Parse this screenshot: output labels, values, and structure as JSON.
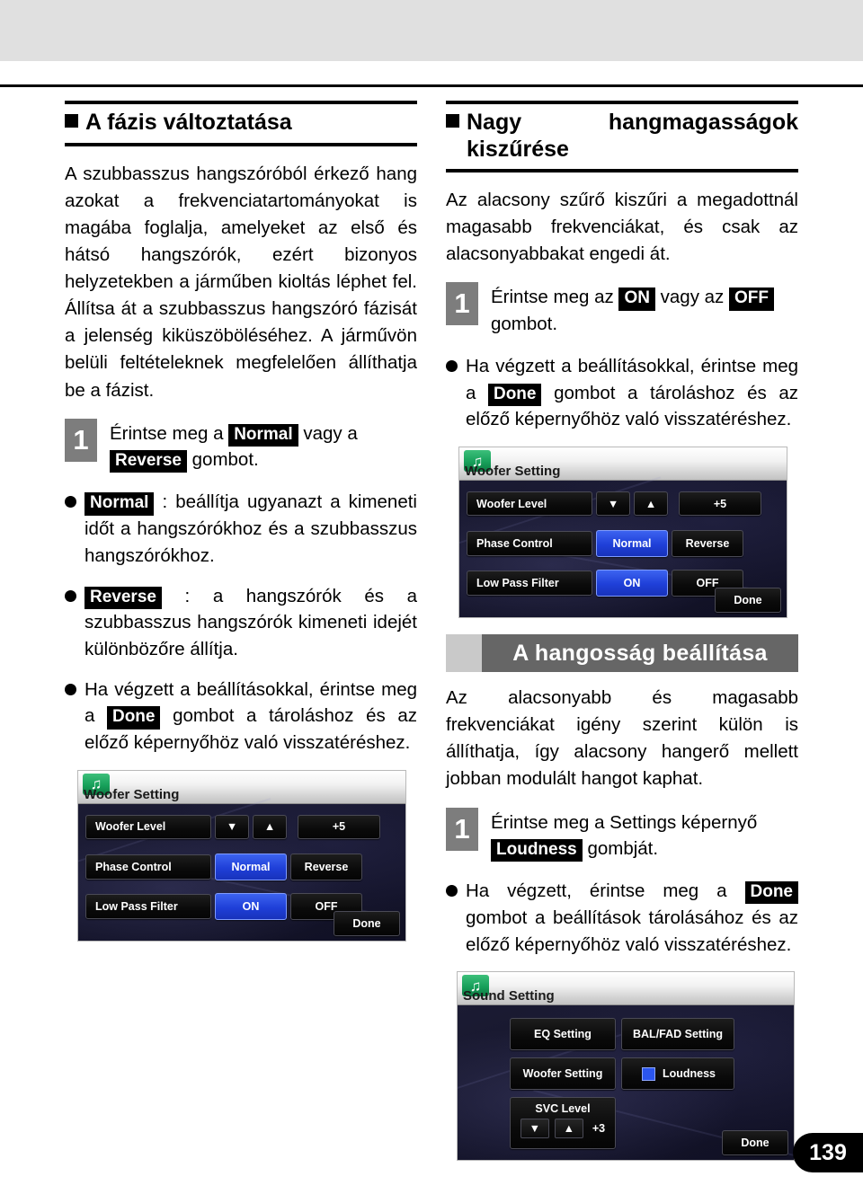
{
  "page": {
    "number": "139"
  },
  "left": {
    "heading": "A fázis változtatása",
    "intro": "A szubbasszus hangszóróból érkező hang azokat a frekvenciatartományokat is magába foglalja, amelyeket az első és hátsó hangszórók, ezért bizonyos helyzetekben a járműben kioltás léphet fel. Állítsa át a szubbasszus hangszóró fázisát a jelenség kiküszöböléséhez. A járművön belüli feltételeknek megfelelően állíthatja be a fázist.",
    "step1": {
      "num": "1",
      "text_before": "Érintse meg a",
      "chip1": "Normal",
      "text_mid": "vagy a",
      "chip2": "Reverse",
      "text_after": "gombot."
    },
    "bullets": [
      {
        "chip": "Normal",
        "text": ": beállítja ugyanazt a kimeneti időt a hangszórókhoz és a szubbasszus hangszórókhoz."
      },
      {
        "chip": "Reverse",
        "text": ":  a  hangszórók  és  a szubbasszus hangszórók kimeneti idejét különbözőre állítja."
      }
    ],
    "done_bullet": {
      "before": "Ha végzett a beállításokkal, érintse meg a",
      "chip": "Done",
      "after": "gombot a tároláshoz és az előző képernyőhöz való visszatéréshez."
    }
  },
  "right": {
    "heading_line1_a": "Nagy",
    "heading_line1_b": "hangmagasságok",
    "heading_line2": "kiszűrése",
    "intro": "Az alacsony szűrő kiszűri a megadottnál magasabb frekvenciákat, és csak az alacsonyabbakat engedi át.",
    "step1": {
      "num": "1",
      "text_before": "Érintse meg az",
      "chip1": "ON",
      "text_mid": "vagy az",
      "chip2": "OFF",
      "text_after": "gombot."
    },
    "done_bullet": {
      "before": "Ha végzett a beállításokkal, érintse meg a",
      "chip": "Done",
      "after": "gombot a tároláshoz és az előző képernyőhöz való visszatéréshez."
    },
    "banner": "A hangosság beállítása",
    "loudness_intro": "Az alacsonyabb és magasabb frekvenciákat igény szerint külön is állíthatja, így alacsony hangerő mellett jobban modulált hangot kaphat.",
    "step_loudness": {
      "num": "1",
      "text_before": "Érintse meg a Settings képernyő",
      "chip": "Loudness",
      "text_after": "gombját."
    },
    "done_bullet2": {
      "before": "Ha végzett, érintse meg a",
      "chip": "Done",
      "after": "gombot a beállítások tárolásához és az előző képernyőhöz való visszatéréshez."
    }
  },
  "woofer_screen": {
    "title": "Woofer Setting",
    "icon": "music-note-icon",
    "rows": {
      "woofer_level_label": "Woofer Level",
      "down_arrow": "▼",
      "up_arrow": "▲",
      "woofer_level_value": "+5",
      "phase_control_label": "Phase Control",
      "phase_normal": "Normal",
      "phase_reverse": "Reverse",
      "low_pass_label": "Low Pass Filter",
      "lpf_on": "ON",
      "lpf_off": "OFF"
    },
    "done": "Done"
  },
  "sound_screen": {
    "title": "Sound Setting",
    "icon": "music-note-icon",
    "buttons": {
      "eq": "EQ Setting",
      "balfad": "BAL/FAD Setting",
      "woofer": "Woofer Setting",
      "loudness": "Loudness",
      "svc_label": "SVC Level",
      "down_arrow": "▼",
      "up_arrow": "▲",
      "svc_value": "+3"
    },
    "done": "Done"
  },
  "colors": {
    "accent_blue": "#2b55ee",
    "banner_gray": "#666666",
    "step_gray": "#7d7d7d"
  }
}
